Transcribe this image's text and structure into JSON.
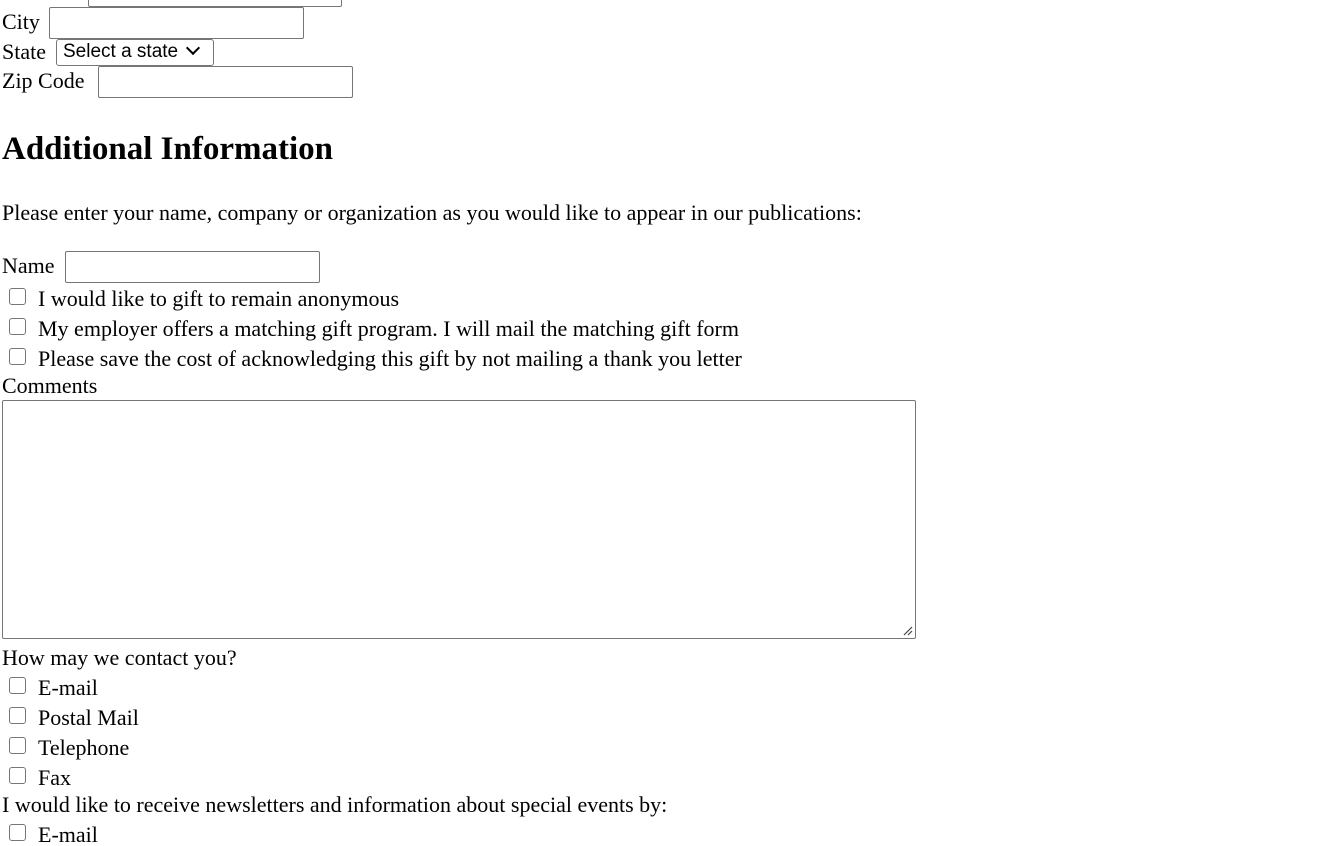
{
  "address": {
    "city_label": "City",
    "state_label": "State",
    "state_selected": "Select a state",
    "zip_label": "Zip Code"
  },
  "additional": {
    "heading": "Additional Information",
    "publication_prompt": "Please enter your name, company or organization as you would like to appear in our publications:",
    "name_label": "Name",
    "options": [
      "I would like to gift to remain anonymous",
      "My employer offers a matching gift program. I will mail the matching gift form",
      "Please save the cost of acknowledging this gift by not mailing a thank you letter"
    ],
    "comments_label": "Comments"
  },
  "contact": {
    "question": "How may we contact you?",
    "methods": [
      "E-mail",
      "Postal Mail",
      "Telephone",
      "Fax"
    ]
  },
  "newsletter": {
    "question": "I would like to receive newsletters and information about special events by:",
    "methods": [
      "E-mail"
    ]
  },
  "colors": {
    "border": "#767676",
    "text": "#000000",
    "background": "#ffffff"
  }
}
